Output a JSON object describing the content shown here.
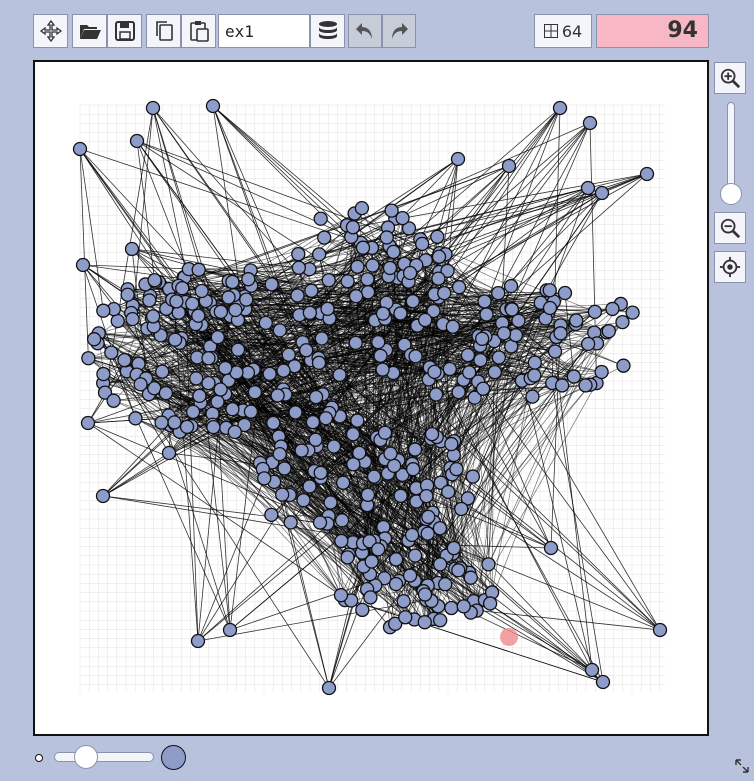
{
  "toolbar": {
    "buttons": [
      {
        "name": "move-tool-button",
        "icon": "move-arrows-icon"
      },
      {
        "name": "open-button",
        "icon": "folder-open-icon"
      },
      {
        "name": "save-button",
        "icon": "floppy-disk-icon"
      },
      {
        "name": "copy-button",
        "icon": "copy-icon"
      },
      {
        "name": "paste-button",
        "icon": "paste-icon"
      }
    ],
    "name_value": "ex1",
    "database_icon": "database-icon",
    "undo_icon": "undo-icon",
    "redo_icon": "redo-icon",
    "grid_icon": "grid-icon",
    "grid_size": "64",
    "score": "94"
  },
  "side": {
    "zoom_in_icon": "zoom-in-icon",
    "zoom_out_icon": "zoom-out-icon",
    "center_icon": "crosshair-icon"
  },
  "colors": {
    "background": "#b8c2dd",
    "node_fill": "#8e9cc9",
    "node_stroke": "#111111",
    "score_bg": "#f8b7c4",
    "highlight": "#f08a8a"
  }
}
